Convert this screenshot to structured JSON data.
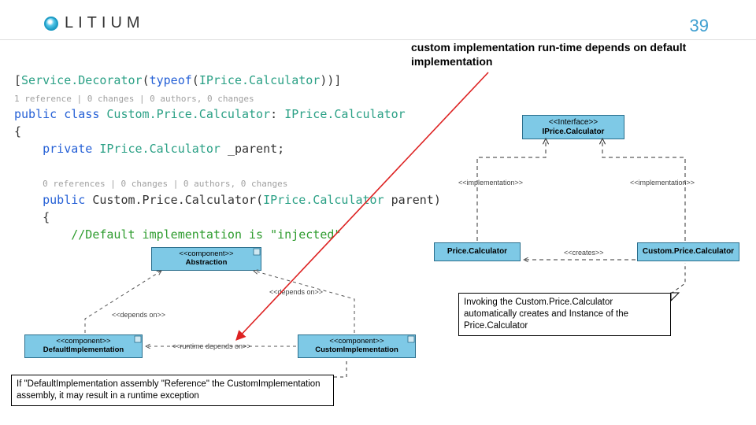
{
  "header": {
    "brand": "LITIUM",
    "page_number": "39"
  },
  "caption": "custom implementation run-time depends on default implementation",
  "code": {
    "attr_open": "[",
    "attr_name": "Service.Decorator",
    "attr_paren_open": "(",
    "typeof": "typeof",
    "attr_type_open": "(",
    "iprice": "IPrice.Calculator",
    "attr_close": "))]",
    "codelens1": "1 reference | 0 changes | 0 authors, 0 changes",
    "public": "public",
    "class": "class",
    "classname": "Custom.Price.Calculator",
    "colon": ": ",
    "brace_open": "{",
    "private": "private",
    "fieldname": "_parent;",
    "codelens2": "0 references | 0 changes | 0 authors, 0 changes",
    "ctor_open": "(",
    "param_name": "parent",
    "ctor_close": ")",
    "brace_open2": "{",
    "comment": "//Default implementation is \"injected\""
  },
  "diagram": {
    "interface_stereo": "<<Interface>>",
    "interface_name": "IPrice.Calculator",
    "impl_label_left": "<<implementation>>",
    "impl_label_right": "<<implementation>>",
    "price_calc": "Price.Calculator",
    "custom_price_calc": "Custom.Price.Calculator",
    "creates_label": "<<creates>>",
    "note_right": "Invoking the Custom.Price.Calculator automatically creates and Instance of the Price.Calculator",
    "comp_stereo": "<<component>>",
    "abstraction": "Abstraction",
    "default_impl": "DefaultImplementation",
    "custom_impl": "CustomImplementation",
    "depends_left": "<<depends on>>",
    "depends_right": "<<depends on>>",
    "runtime_label": "<<runtime depends on>>",
    "note_bottom": "If \"DefaultImplementation assembly \"Reference\" the CustomImplementation assembly, it may result in a runtime exception"
  }
}
